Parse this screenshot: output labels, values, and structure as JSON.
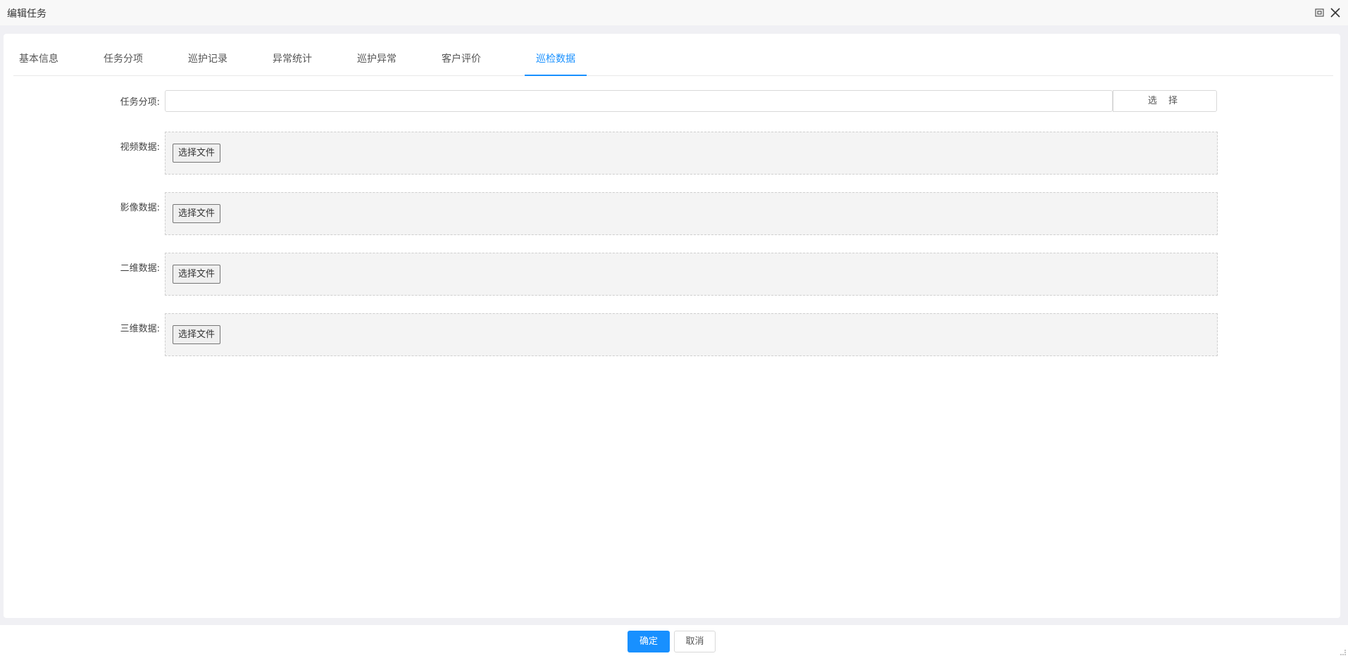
{
  "window": {
    "title": "编辑任务",
    "maximize_icon": "restore-window-icon",
    "close_icon": "close-icon"
  },
  "tabs": [
    {
      "label": "基本信息",
      "active": false
    },
    {
      "label": "任务分项",
      "active": false
    },
    {
      "label": "巡护记录",
      "active": false
    },
    {
      "label": "异常统计",
      "active": false
    },
    {
      "label": "巡护异常",
      "active": false
    },
    {
      "label": "客户评价",
      "active": false
    },
    {
      "label": "巡检数据",
      "active": true
    }
  ],
  "form": {
    "task_item": {
      "label": "任务分项:",
      "value": "",
      "select_label": "选 择"
    },
    "uploads": [
      {
        "label": "视频数据:",
        "button": "选择文件"
      },
      {
        "label": "影像数据:",
        "button": "选择文件"
      },
      {
        "label": "二维数据:",
        "button": "选择文件"
      },
      {
        "label": "三维数据:",
        "button": "选择文件"
      }
    ]
  },
  "footer": {
    "ok_label": "确定",
    "cancel_label": "取消"
  },
  "colors": {
    "accent": "#1890ff",
    "upload_bg": "#f4f4f4"
  }
}
